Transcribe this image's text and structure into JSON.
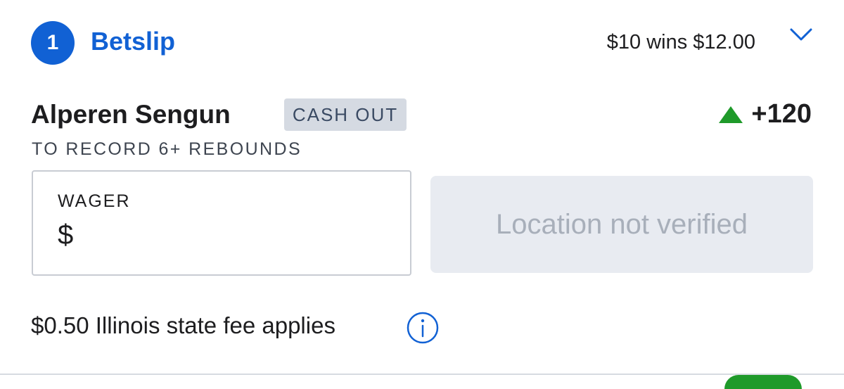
{
  "header": {
    "bet_count": "1",
    "title": "Betslip",
    "summary": "$10 wins $12.00",
    "chevron_icon": "chevron-down-icon"
  },
  "selection": {
    "player": "Alperen Sengun",
    "cashout_label": "CASH OUT",
    "odds": "+120",
    "odds_trend_icon": "triangle-up-icon",
    "odds_trend_color": "#1f9a2a",
    "market": "TO RECORD 6+ REBOUNDS"
  },
  "wager": {
    "label": "WAGER",
    "currency": "$",
    "value": ""
  },
  "location_button": {
    "label": "Location not verified"
  },
  "fee": {
    "text": "$0.50 Illinois state fee applies",
    "info_icon": "info-icon"
  },
  "colors": {
    "accent": "#1161d4",
    "badge_bg": "#d5dae2",
    "disabled_bg": "#e8ebf1",
    "disabled_text": "#a8afba"
  }
}
